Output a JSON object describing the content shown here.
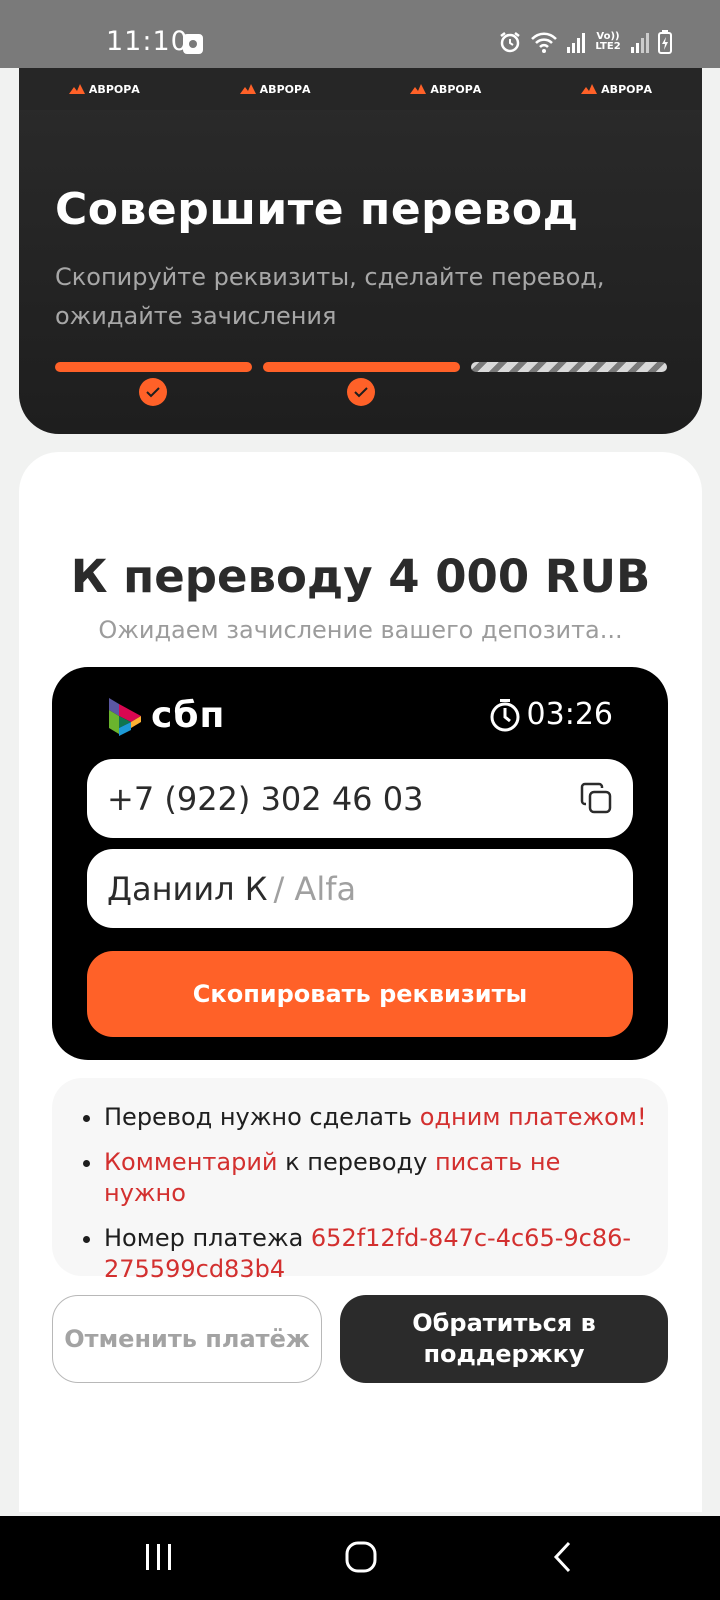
{
  "status_bar": {
    "time": "11:10",
    "network": "Vo)) LTE2"
  },
  "hero": {
    "brand_logos": [
      "АВРОРА",
      "АВРОРА",
      "АВРОРА",
      "АВРОРА"
    ],
    "title": "Совершите перевод",
    "subtitle": "Скопируйте реквизиты, сделайте перевод, ожидайте зачисления",
    "progress_steps": [
      {
        "state": "done"
      },
      {
        "state": "done"
      },
      {
        "state": "pending"
      }
    ]
  },
  "transfer": {
    "title": "К переводу 4 000 RUB",
    "waiting": "Ожидаем зачисление вашего депозита...",
    "method": "сбп",
    "timer": "03:26",
    "phone": "+7 (922) 302 46 03",
    "recipient_name": "Даниил К",
    "bank": "/ Alfa",
    "copy_button": "Скопировать реквизиты"
  },
  "notes": {
    "item1_text": "Перевод нужно сделать ",
    "item1_red": "одним платежом!",
    "item2_red1": "Комментарий",
    "item2_text": " к переводу ",
    "item2_red2": "писать не нужно",
    "item3_text": "Номер платежа ",
    "item3_red": "652f12fd-847c-4c65-9c86-275599cd83b4"
  },
  "actions": {
    "cancel": "Отменить платёж",
    "support": "Обратиться в поддержку"
  },
  "colors": {
    "accent": "#ff6128",
    "dark": "#2b2b2b",
    "warning_text": "#d3302f"
  }
}
